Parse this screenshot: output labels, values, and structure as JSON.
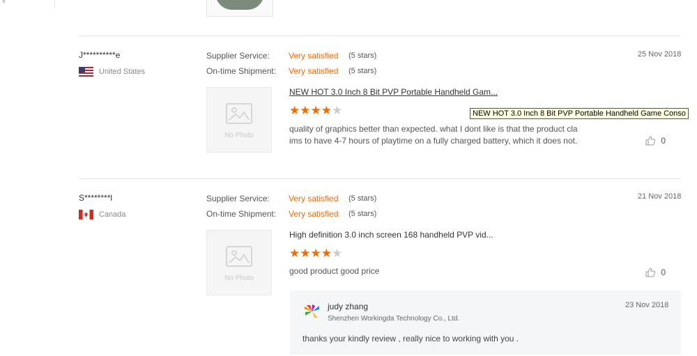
{
  "sidebar": {
    "stub_text": "ʰ"
  },
  "reviews": [
    {
      "username": "J**********e",
      "country": "United States",
      "supplier_label": "Supplier Service:",
      "supplier_value": "Very satisfied",
      "supplier_stars": "(5 stars)",
      "shipment_label": "On-time Shipment:",
      "shipment_value": "Very satisfied",
      "shipment_stars": "(5 stars)",
      "date": "25 Nov 2018",
      "photo_text": "No Photo",
      "product": "NEW HOT 3.0 Inch 8 Bit PVP Portable Handheld Gam...",
      "rating": 4,
      "review_line1": "quality of graphics better than expected. what I dont like is that the product cla",
      "review_line2": "ims to have 4-7 hours of playtime on a fully charged battery, which it does not.",
      "likes": "0"
    },
    {
      "username": "S********l",
      "country": "Canada",
      "supplier_label": "Supplier Service:",
      "supplier_value": "Very satisfied",
      "supplier_stars": "(5 stars)",
      "shipment_label": "On-time Shipment:",
      "shipment_value": "Very satisfied",
      "shipment_stars": "(5 stars)",
      "date": "21 Nov 2018",
      "photo_text": "No Photo",
      "product": "High definition 3.0 inch screen 168 handheld PVP vid...",
      "rating": 4,
      "review_line1": "good product good price",
      "likes": "0",
      "reply": {
        "name": "judy zhang",
        "company": "Shenzhen Workingda Technology Co., Ltd.",
        "date": "23 Nov 2018",
        "text": "thanks your kindly review , really  nice to working with you ."
      }
    }
  ],
  "tooltip": "NEW HOT 3.0 Inch 8 Bit PVP Portable Handheld Game Conso",
  "colors": {
    "accent": "#f56a00",
    "star_off": "#cccccc",
    "divider": "#e5e5e5"
  }
}
